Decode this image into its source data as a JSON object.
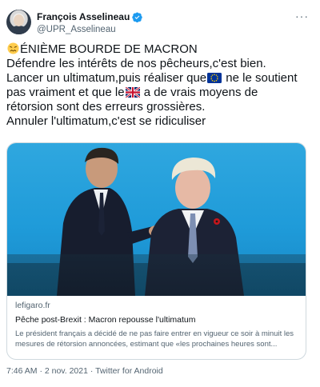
{
  "author": {
    "name": "François Asselineau",
    "handle": "@UPR_Asselineau",
    "avatar_icon": "user-avatar",
    "verified_icon": "verified-badge-icon",
    "verified_color": "#1d9bf0"
  },
  "more_label": "···",
  "tweet": {
    "lines": [
      {
        "prefix_emoji": "confounded-face",
        "text": "ÉNIÈME BOURDE DE MACRON"
      },
      {
        "text": "Défendre les intérêts de nos pêcheurs,c'est bien."
      },
      {
        "before": "Lancer un ultimatum,puis réaliser que",
        "emoji": "eu-flag",
        "after": " ne le soutient"
      },
      {
        "text": "pas vraiment et que le",
        "emoji": "uk-flag",
        "after": " a de vrais moyens de"
      },
      {
        "text": "rétorsion sont des erreurs grossières."
      },
      {
        "text": "Annuler l'ultimatum,c'est se ridiculiser"
      }
    ]
  },
  "card": {
    "image_icon": "news-photo",
    "domain": "lefigaro.fr",
    "title": "Pêche post-Brexit : Macron repousse l'ultimatum",
    "description": "Le président français a décidé de ne pas faire entrer en vigueur ce soir à minuit les mesures de rétorsion annoncées, estimant que «les prochaines heures sont..."
  },
  "footer": {
    "timestamp": "7:46 AM · 2 nov. 2021 · Twitter for Android"
  },
  "colors": {
    "text": "#0f1419",
    "muted": "#536471",
    "border": "#cfd9de",
    "accent": "#1d9bf0"
  }
}
